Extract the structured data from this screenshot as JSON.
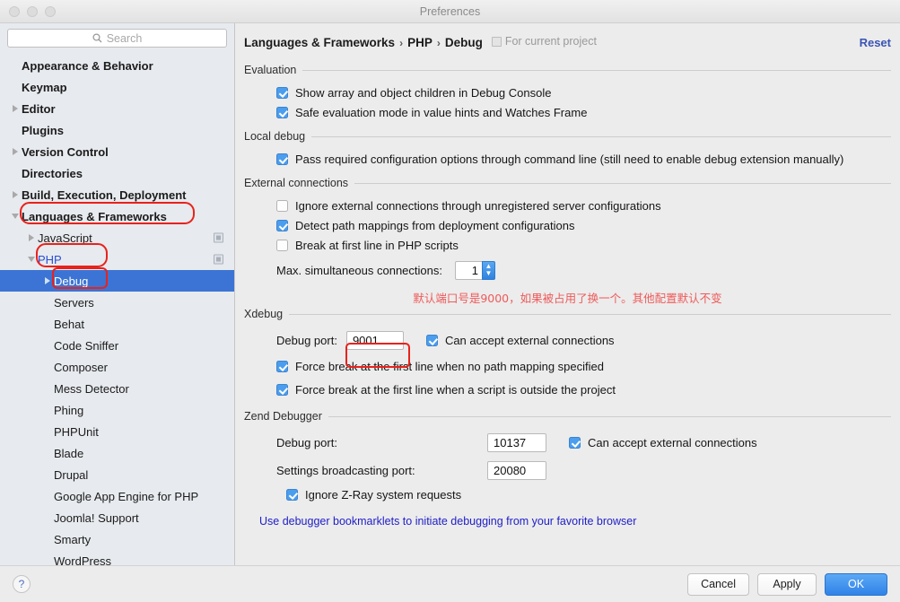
{
  "window": {
    "title": "Preferences"
  },
  "sidebar": {
    "search": {
      "placeholder": "Search"
    },
    "items": [
      {
        "label": "Appearance & Behavior",
        "indent": 0,
        "twisty": "none",
        "bold": true,
        "selected": false,
        "scope_icon": false
      },
      {
        "label": "Keymap",
        "indent": 0,
        "twisty": "none",
        "bold": true,
        "selected": false,
        "scope_icon": false
      },
      {
        "label": "Editor",
        "indent": 0,
        "twisty": "right",
        "bold": true,
        "selected": false,
        "scope_icon": false
      },
      {
        "label": "Plugins",
        "indent": 0,
        "twisty": "none",
        "bold": true,
        "selected": false,
        "scope_icon": false
      },
      {
        "label": "Version Control",
        "indent": 0,
        "twisty": "right",
        "bold": true,
        "selected": false,
        "scope_icon": false
      },
      {
        "label": "Directories",
        "indent": 0,
        "twisty": "none",
        "bold": true,
        "selected": false,
        "scope_icon": false
      },
      {
        "label": "Build, Execution, Deployment",
        "indent": 0,
        "twisty": "right",
        "bold": true,
        "selected": false,
        "scope_icon": false
      },
      {
        "label": "Languages & Frameworks",
        "indent": 0,
        "twisty": "down",
        "bold": true,
        "selected": false,
        "scope_icon": false
      },
      {
        "label": "JavaScript",
        "indent": 1,
        "twisty": "right",
        "bold": false,
        "selected": false,
        "scope_icon": true
      },
      {
        "label": "PHP",
        "indent": 1,
        "twisty": "down",
        "bold": false,
        "selected": false,
        "scope_icon": true,
        "link": true
      },
      {
        "label": "Debug",
        "indent": 2,
        "twisty": "right",
        "bold": false,
        "selected": true,
        "scope_icon": false
      },
      {
        "label": "Servers",
        "indent": 2,
        "twisty": "none",
        "bold": false,
        "selected": false,
        "scope_icon": false
      },
      {
        "label": "Behat",
        "indent": 2,
        "twisty": "none",
        "bold": false,
        "selected": false,
        "scope_icon": false
      },
      {
        "label": "Code Sniffer",
        "indent": 2,
        "twisty": "none",
        "bold": false,
        "selected": false,
        "scope_icon": false
      },
      {
        "label": "Composer",
        "indent": 2,
        "twisty": "none",
        "bold": false,
        "selected": false,
        "scope_icon": false
      },
      {
        "label": "Mess Detector",
        "indent": 2,
        "twisty": "none",
        "bold": false,
        "selected": false,
        "scope_icon": false
      },
      {
        "label": "Phing",
        "indent": 2,
        "twisty": "none",
        "bold": false,
        "selected": false,
        "scope_icon": false
      },
      {
        "label": "PHPUnit",
        "indent": 2,
        "twisty": "none",
        "bold": false,
        "selected": false,
        "scope_icon": false
      },
      {
        "label": "Blade",
        "indent": 2,
        "twisty": "none",
        "bold": false,
        "selected": false,
        "scope_icon": false
      },
      {
        "label": "Drupal",
        "indent": 2,
        "twisty": "none",
        "bold": false,
        "selected": false,
        "scope_icon": false
      },
      {
        "label": "Google App Engine for PHP",
        "indent": 2,
        "twisty": "none",
        "bold": false,
        "selected": false,
        "scope_icon": false
      },
      {
        "label": "Joomla! Support",
        "indent": 2,
        "twisty": "none",
        "bold": false,
        "selected": false,
        "scope_icon": false
      },
      {
        "label": "Smarty",
        "indent": 2,
        "twisty": "none",
        "bold": false,
        "selected": false,
        "scope_icon": false
      },
      {
        "label": "WordPress",
        "indent": 2,
        "twisty": "none",
        "bold": false,
        "selected": false,
        "scope_icon": false
      }
    ]
  },
  "header": {
    "crumb1": "Languages & Frameworks",
    "crumb2": "PHP",
    "crumb3": "Debug",
    "separator": "›",
    "scope_note": "For current project",
    "reset_label": "Reset"
  },
  "sections": {
    "evaluation": {
      "title": "Evaluation",
      "checkboxes": [
        {
          "label": "Show array and object children in Debug Console",
          "checked": true
        },
        {
          "label": "Safe evaluation mode in value hints and Watches Frame",
          "checked": true
        }
      ]
    },
    "local_debug": {
      "title": "Local debug",
      "checkboxes": [
        {
          "label": "Pass required configuration options through command line (still need to enable debug extension manually)",
          "checked": true
        }
      ]
    },
    "external_connections": {
      "title": "External connections",
      "checkboxes": [
        {
          "label": "Ignore external connections through unregistered server configurations",
          "checked": false
        },
        {
          "label": "Detect path mappings from deployment configurations",
          "checked": true
        },
        {
          "label": "Break at first line in PHP scripts",
          "checked": false
        }
      ],
      "max_connections_label": "Max. simultaneous connections:",
      "max_connections_value": "1"
    },
    "xdebug": {
      "title": "Xdebug",
      "debug_port_label": "Debug port:",
      "debug_port_value": "9001",
      "accept_external_label": "Can accept external connections",
      "accept_external_checked": true,
      "checkboxes": [
        {
          "label": "Force break at the first line when no path mapping specified",
          "checked": true
        },
        {
          "label": "Force break at the first line when a script is outside the project",
          "checked": true
        }
      ]
    },
    "zend": {
      "title": "Zend Debugger",
      "debug_port_label": "Debug port:",
      "debug_port_value": "10137",
      "accept_external_label": "Can accept external connections",
      "accept_external_checked": true,
      "broadcast_label": "Settings broadcasting port:",
      "broadcast_value": "20080",
      "zray_label": "Ignore Z-Ray system requests",
      "zray_checked": true
    },
    "bookmarklet_link": "Use debugger bookmarklets to initiate debugging from your favorite browser"
  },
  "annotation": {
    "note_zh": "默认端口号是9000，如果被占用了换一个。其他配置默认不变",
    "color": "#ef5a5a",
    "box_color": "#e8221c"
  },
  "footer": {
    "help_label": "?",
    "cancel_label": "Cancel",
    "apply_label": "Apply",
    "ok_label": "OK"
  }
}
